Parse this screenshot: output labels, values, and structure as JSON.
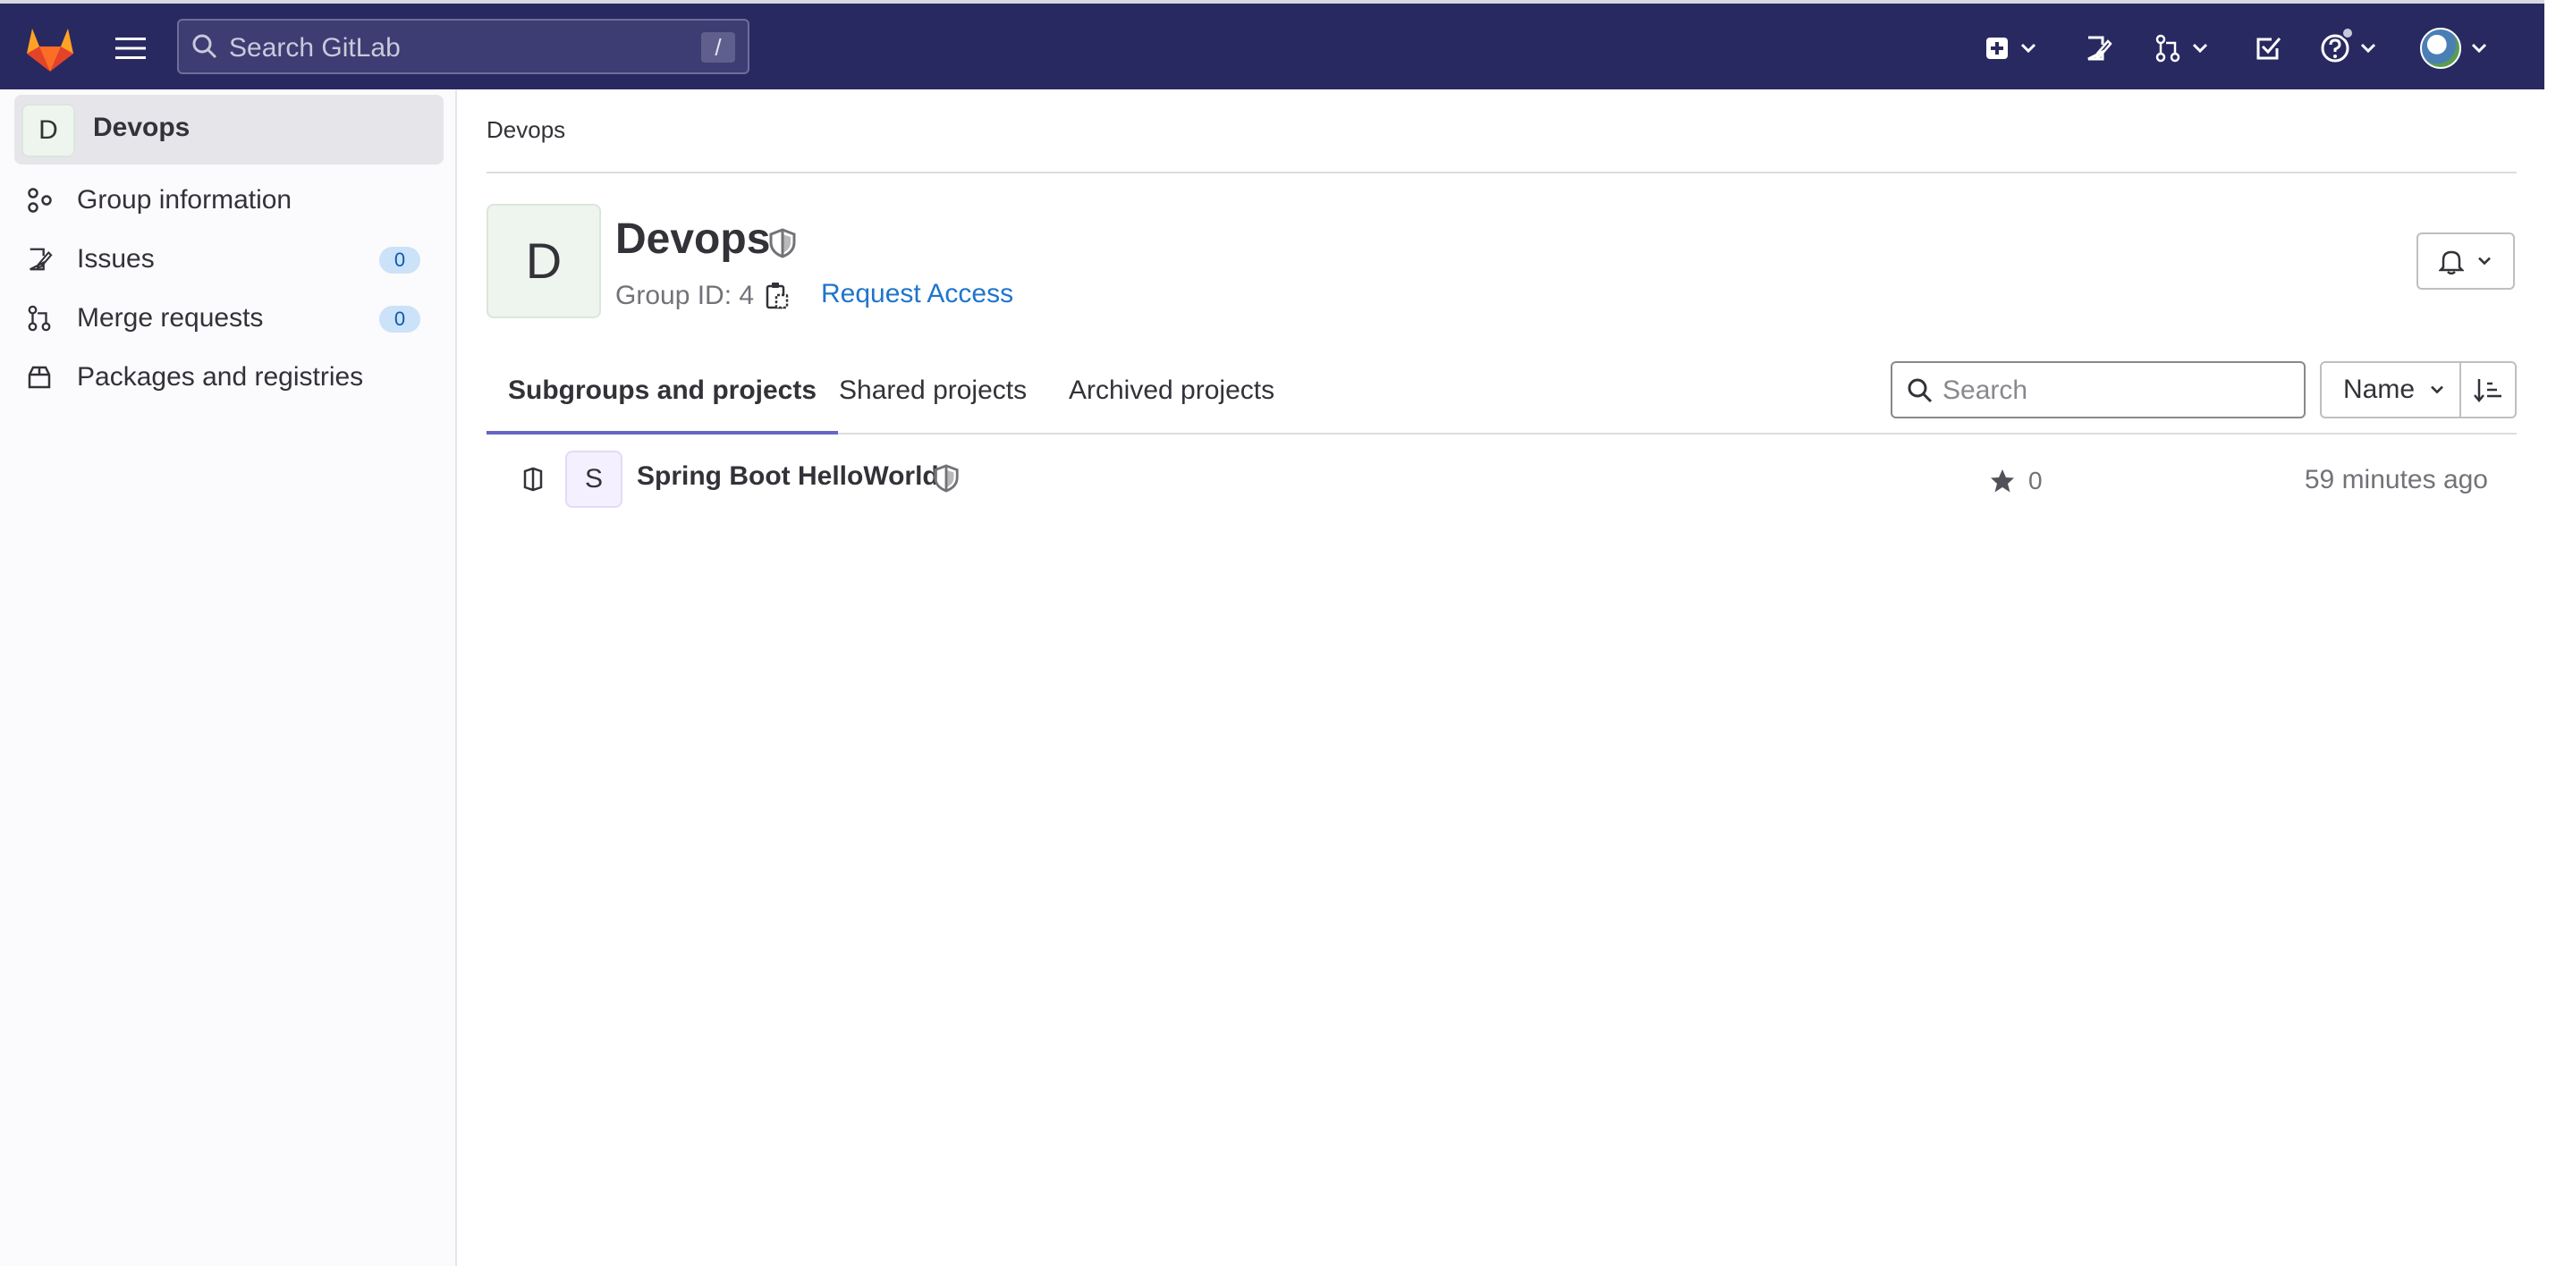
{
  "topbar": {
    "search_placeholder": "Search GitLab",
    "search_shortcut": "/"
  },
  "sidebar": {
    "group_initial": "D",
    "group_name": "Devops",
    "items": [
      {
        "label": "Group information",
        "icon": "group-info-icon"
      },
      {
        "label": "Issues",
        "icon": "issues-icon",
        "count": "0"
      },
      {
        "label": "Merge requests",
        "icon": "merge-request-icon",
        "count": "0"
      },
      {
        "label": "Packages and registries",
        "icon": "package-icon"
      }
    ]
  },
  "breadcrumb": "Devops",
  "group": {
    "initial": "D",
    "title": "Devops",
    "id_label": "Group ID: 4",
    "request_access": "Request Access"
  },
  "tabs": [
    "Subgroups and projects",
    "Shared projects",
    "Archived projects"
  ],
  "filter": {
    "search_placeholder": "Search",
    "sort_label": "Name"
  },
  "projects": [
    {
      "initial": "S",
      "name": "Spring Boot HelloWorld",
      "stars": "0",
      "updated": "59 minutes ago"
    }
  ],
  "colors": {
    "topbar": "#292961",
    "accent_tab": "#6666c4",
    "link": "#1f75cb"
  }
}
